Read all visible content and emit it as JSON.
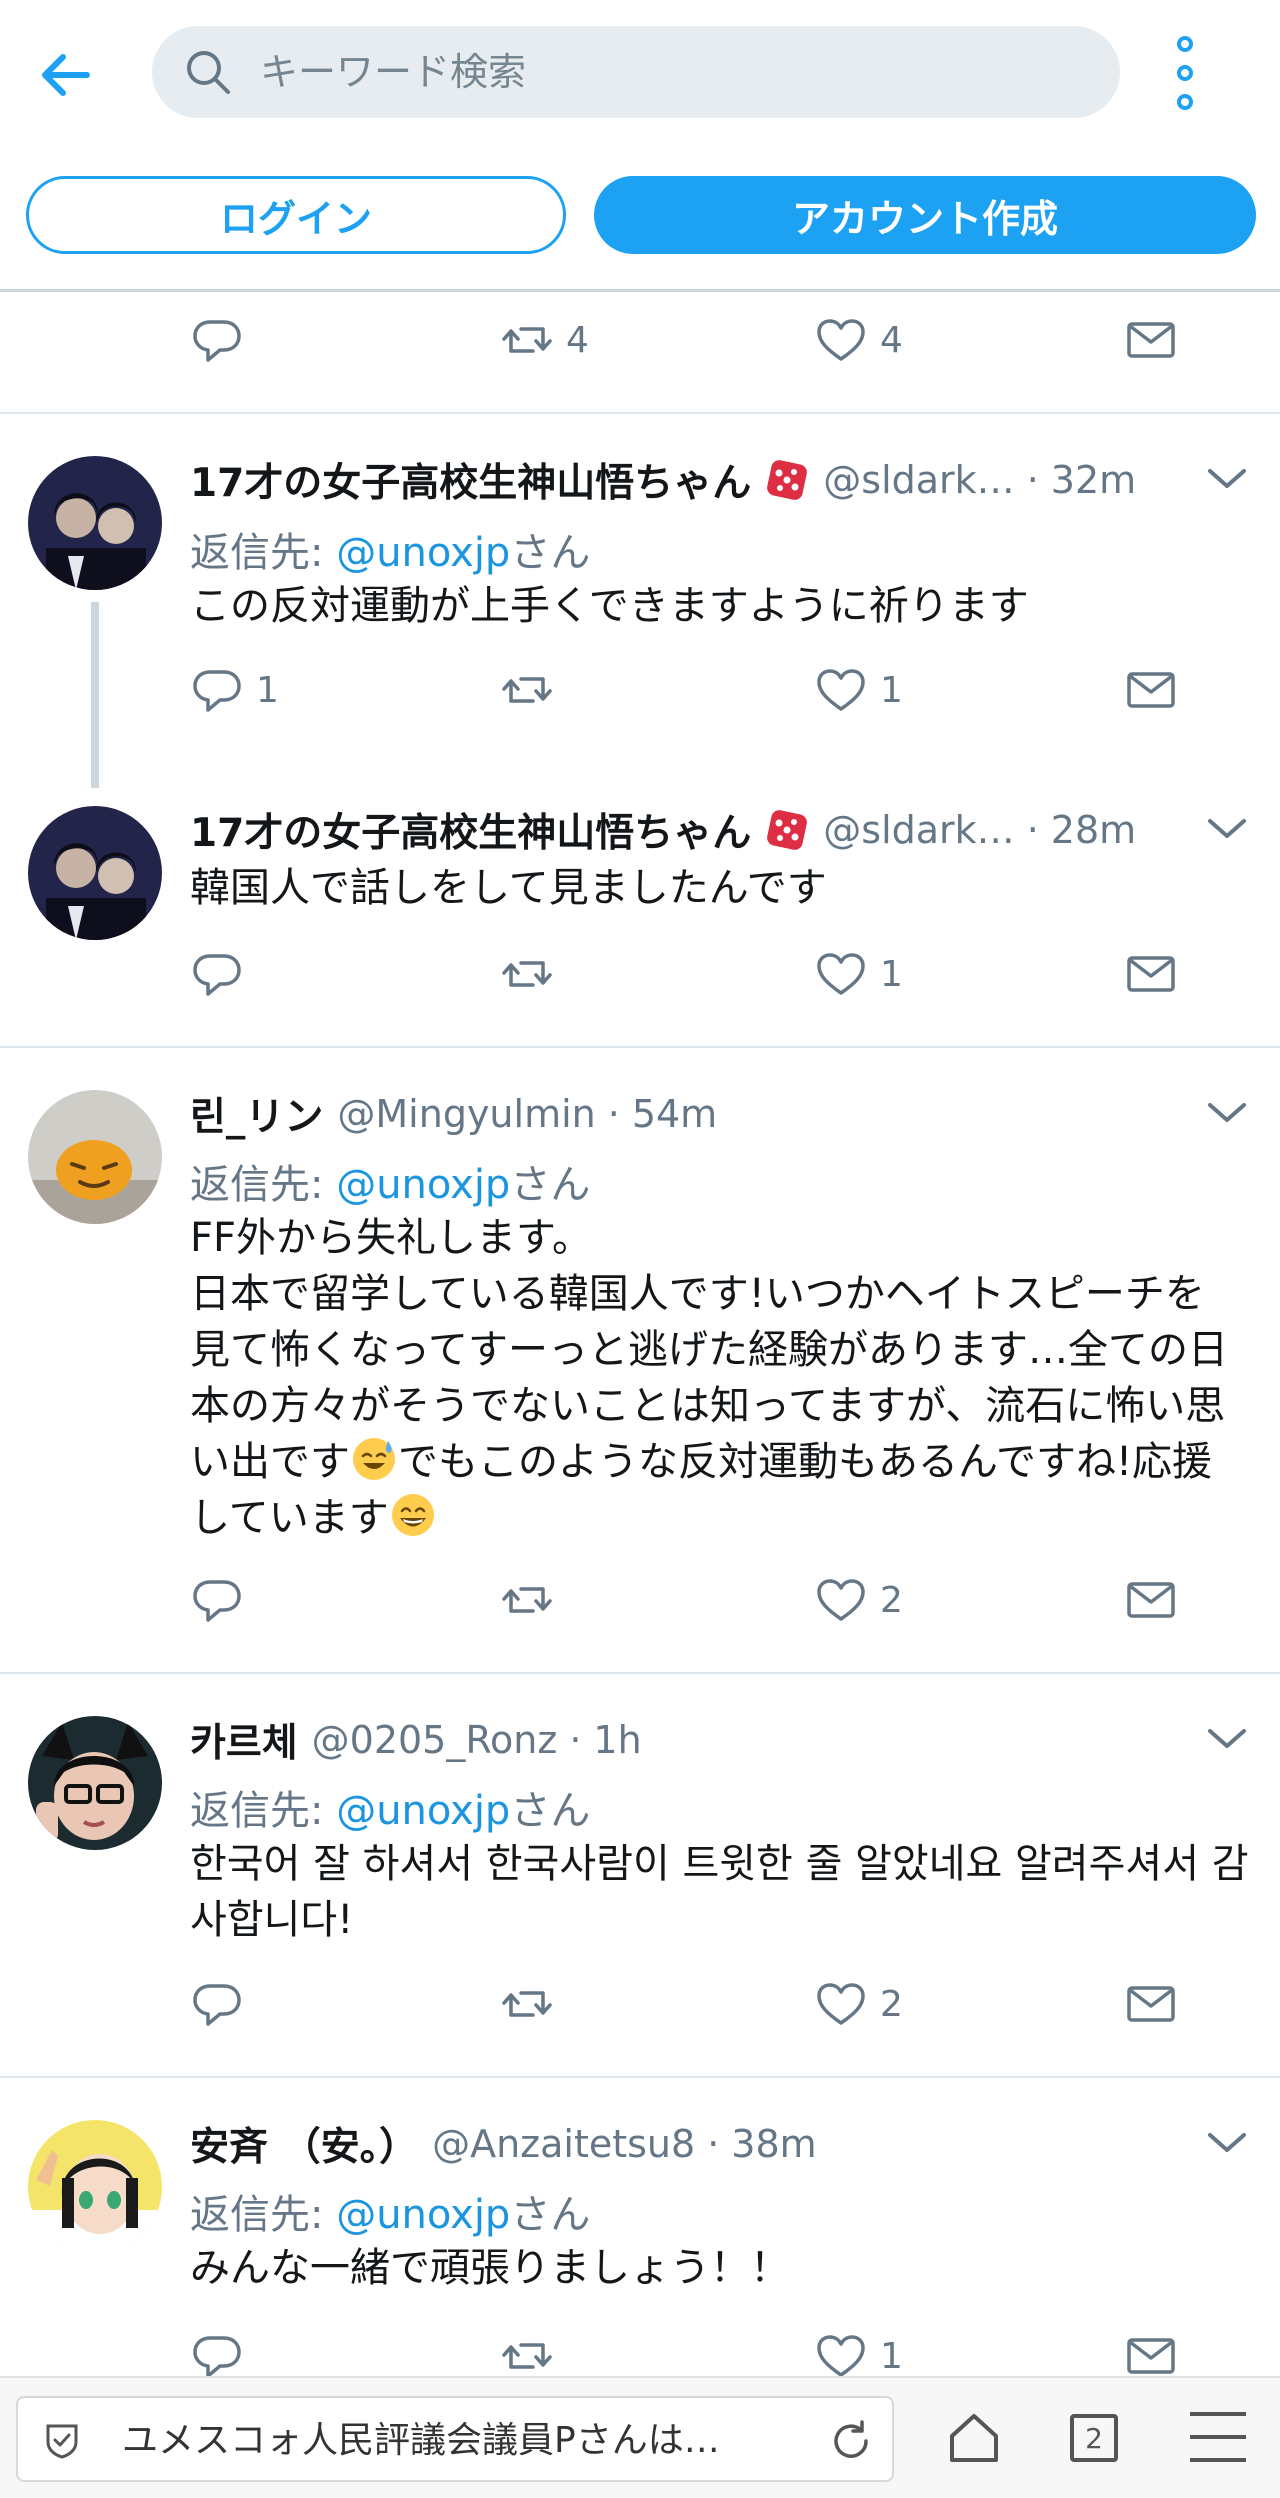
{
  "header": {
    "search_placeholder": "キーワード検索",
    "login_label": "ログイン",
    "signup_label": "アカウント作成"
  },
  "top_actions": {
    "retweets": "4",
    "likes": "4"
  },
  "tweets": [
    {
      "name": "17才の女子高校生神山悟ちゃん",
      "handle": "@sldark…",
      "time": "32m",
      "reply_prefix": "返信先: ",
      "reply_handle": "@unoxjp",
      "reply_suffix": "さん",
      "text": "この反対運動が上手くできますように祈ります",
      "replies": "1",
      "retweets": "",
      "likes": "1"
    },
    {
      "name": "17才の女子高校生神山悟ちゃん",
      "handle": "@sldark…",
      "time": "28m",
      "text": "韓国人で話しをして見ましたんです",
      "replies": "",
      "retweets": "",
      "likes": "1"
    },
    {
      "name": "린_リン",
      "handle": "@Mingyulmin",
      "time": "54m",
      "reply_prefix": "返信先: ",
      "reply_handle": "@unoxjp",
      "reply_suffix": "さん",
      "text_lines": [
        "FF外から失礼します。",
        "日本で留学している韓国人です!いつかヘイトスピーチを",
        "見て怖くなってすーっと逃げた経験があります…全ての日",
        "本の方々がそうでないことは知ってますが、流石に怖い思",
        "い出です",
        "でもこのような反対運動もあるんですね!応援",
        "しています"
      ],
      "replies": "",
      "retweets": "",
      "likes": "2"
    },
    {
      "name": "카르체",
      "handle": "@0205_Ronz",
      "time": "1h",
      "reply_prefix": "返信先: ",
      "reply_handle": "@unoxjp",
      "reply_suffix": "さん",
      "text_lines": [
        "한국어 잘 하셔서 한국사람이 트윗한 줄 알았네요 알려주셔서 감",
        "사합니다!"
      ],
      "replies": "",
      "retweets": "",
      "likes": "2"
    },
    {
      "name": "安斉 （安。）",
      "handle": "@Anzaitetsu8",
      "time": "38m",
      "reply_prefix": "返信先: ",
      "reply_handle": "@unoxjp",
      "reply_suffix": "さん",
      "text": "みんな一緒で頑張りましょう！！",
      "replies": "",
      "retweets": "",
      "likes": "1"
    }
  ],
  "separator": "·",
  "browser": {
    "url_title": "ユメスコォ人民評議会議員Pさんは…",
    "tab_count": "2"
  },
  "colors": {
    "accent": "#1da1f2",
    "link": "#1b95e0",
    "muted": "#657786"
  }
}
